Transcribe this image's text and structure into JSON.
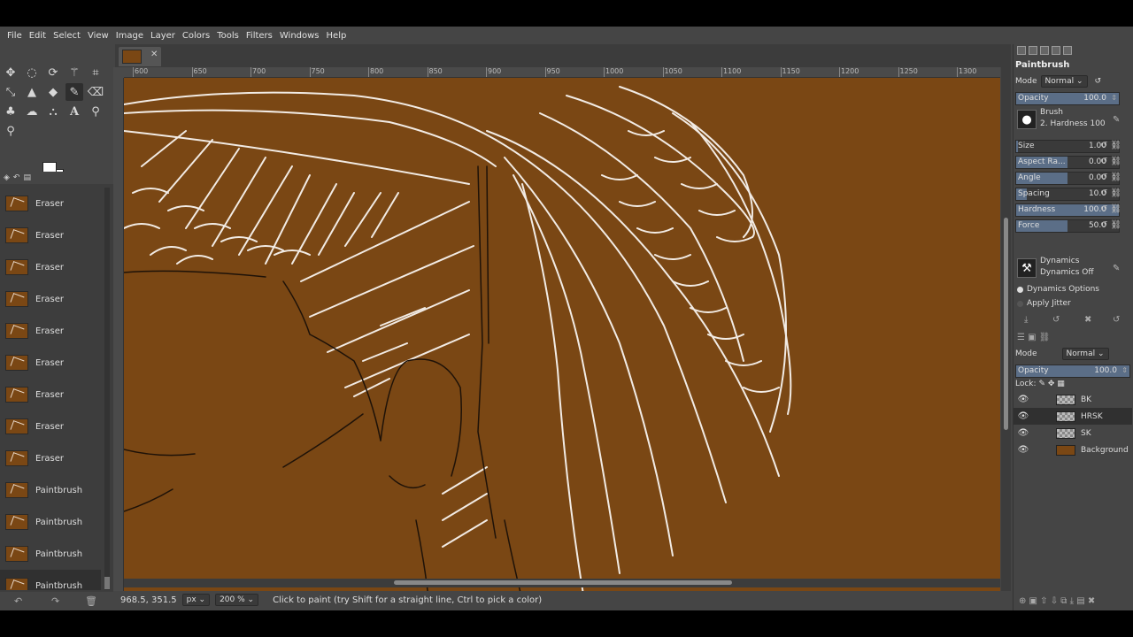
{
  "menu": [
    "File",
    "Edit",
    "Select",
    "View",
    "Image",
    "Layer",
    "Colors",
    "Tools",
    "Filters",
    "Windows",
    "Help"
  ],
  "history": {
    "items": [
      {
        "label": "Eraser"
      },
      {
        "label": "Eraser"
      },
      {
        "label": "Eraser"
      },
      {
        "label": "Eraser"
      },
      {
        "label": "Eraser"
      },
      {
        "label": "Eraser"
      },
      {
        "label": "Eraser"
      },
      {
        "label": "Eraser"
      },
      {
        "label": "Eraser"
      },
      {
        "label": "Paintbrush"
      },
      {
        "label": "Paintbrush"
      },
      {
        "label": "Paintbrush"
      },
      {
        "label": "Paintbrush"
      }
    ],
    "selected_index": 12
  },
  "ruler": {
    "labels": [
      "600",
      "650",
      "700",
      "750",
      "800",
      "850",
      "900",
      "950",
      "1000",
      "1050",
      "1100",
      "1150",
      "1200",
      "1250",
      "1300"
    ]
  },
  "status": {
    "coords": "968.5, 351.5",
    "unit": "px",
    "zoom": "200 %",
    "message": "Click to paint (try Shift for a straight line, Ctrl to pick a color)"
  },
  "tool_options": {
    "title": "Paintbrush",
    "mode_label": "Mode",
    "mode_value": "Normal",
    "opacity_label": "Opacity",
    "opacity_value": "100.0",
    "brush_label": "Brush",
    "brush_name": "2. Hardness 100",
    "params": [
      {
        "label": "Size",
        "value": "1.00",
        "fill": 0.02
      },
      {
        "label": "Aspect Ra...",
        "value": "0.00",
        "fill": 0.5
      },
      {
        "label": "Angle",
        "value": "0.00",
        "fill": 0.5
      },
      {
        "label": "Spacing",
        "value": "10.0",
        "fill": 0.1
      },
      {
        "label": "Hardness",
        "value": "100.0",
        "fill": 1.0
      },
      {
        "label": "Force",
        "value": "50.0",
        "fill": 0.5
      }
    ],
    "dynamics_label": "Dynamics",
    "dynamics_value": "Dynamics Off",
    "dynamics_options": "Dynamics Options",
    "apply_jitter": "Apply Jitter"
  },
  "layers_panel": {
    "mode_label": "Mode",
    "mode_value": "Normal",
    "opacity_label": "Opacity",
    "opacity_value": "100.0",
    "lock_label": "Lock:",
    "layers": [
      {
        "name": "BK",
        "selected": false
      },
      {
        "name": "HRSK",
        "selected": true
      },
      {
        "name": "SK",
        "selected": false
      },
      {
        "name": "Background",
        "selected": false
      }
    ]
  },
  "colors": {
    "canvas": "#7a4714",
    "stroke_white": "#f2ebe4",
    "stroke_dark": "#1e1208",
    "panel": "#454545",
    "slider_fill": "#5b6e87"
  }
}
